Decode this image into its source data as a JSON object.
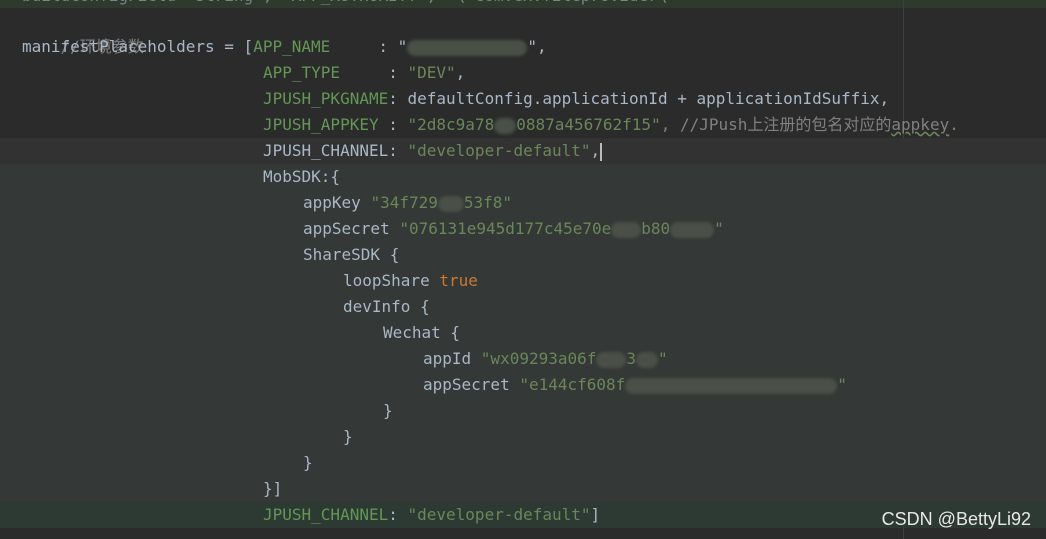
{
  "top_partial": "buildConfigField \"String\", \"APP_AUTHORITY\", \"\\\"com.ex.fileprovider\\\"\"",
  "lines": {
    "l1": "//环境参数",
    "l2_a": "manifestPlaceholders = [",
    "l2_b": "APP_NAME",
    "l2_c": "     : \"",
    "l2_d": "\",",
    "l3_a": "APP_TYPE",
    "l3_b": "     : ",
    "l3_c": "\"DEV\"",
    "l3_d": ",",
    "l4_a": "JPUSH_PKGNAME",
    "l4_b": ": defaultConfig.applicationId + applicationIdSuffix,",
    "l5_a": "JPUSH_APPKEY",
    "l5_b": " : ",
    "l5_c": "\"2d8c9a78",
    "l5_d": "0887a456762f15\"",
    "l5_e": ", //JPush上注册的包名对应的",
    "l5_f": "appkey",
    "l5_g": ".",
    "l6_a": "JPUSH_CHANNEL",
    "l6_b": ": ",
    "l6_c": "\"developer-default\"",
    "l6_d": ",",
    "l7": "MobSDK:{",
    "l8_a": "appKey ",
    "l8_b": "\"34f729",
    "l8_c": "53f8\"",
    "l9_a": "appSecret ",
    "l9_b": "\"076131e945d177c45e70e",
    "l9_c": "b80",
    "l9_d": "\"",
    "l10": "ShareSDK {",
    "l11_a": "loopShare ",
    "l11_b": "true",
    "l12": "devInfo {",
    "l13": "Wechat {",
    "l14_a": "appId ",
    "l14_b": "\"wx09293a06f",
    "l14_c": "3",
    "l14_d": "\"",
    "l15_a": "appSecret ",
    "l15_b": "\"e144cf608f",
    "l15_c": "\"",
    "l16": "}",
    "l17": "}",
    "l18": "}",
    "l19": "}]",
    "l20_a": "JPUSH_CHANNEL",
    "l20_b": ": ",
    "l20_c": "\"developer-default\"",
    "l20_d": "]"
  },
  "watermark": "CSDN @BettyLi92",
  "colors": {
    "background": "#2b2b2b",
    "comment": "#808080",
    "constant": "#9876aa",
    "string": "#6a8759",
    "keyword": "#cc7832",
    "text": "#a9b7c6"
  }
}
